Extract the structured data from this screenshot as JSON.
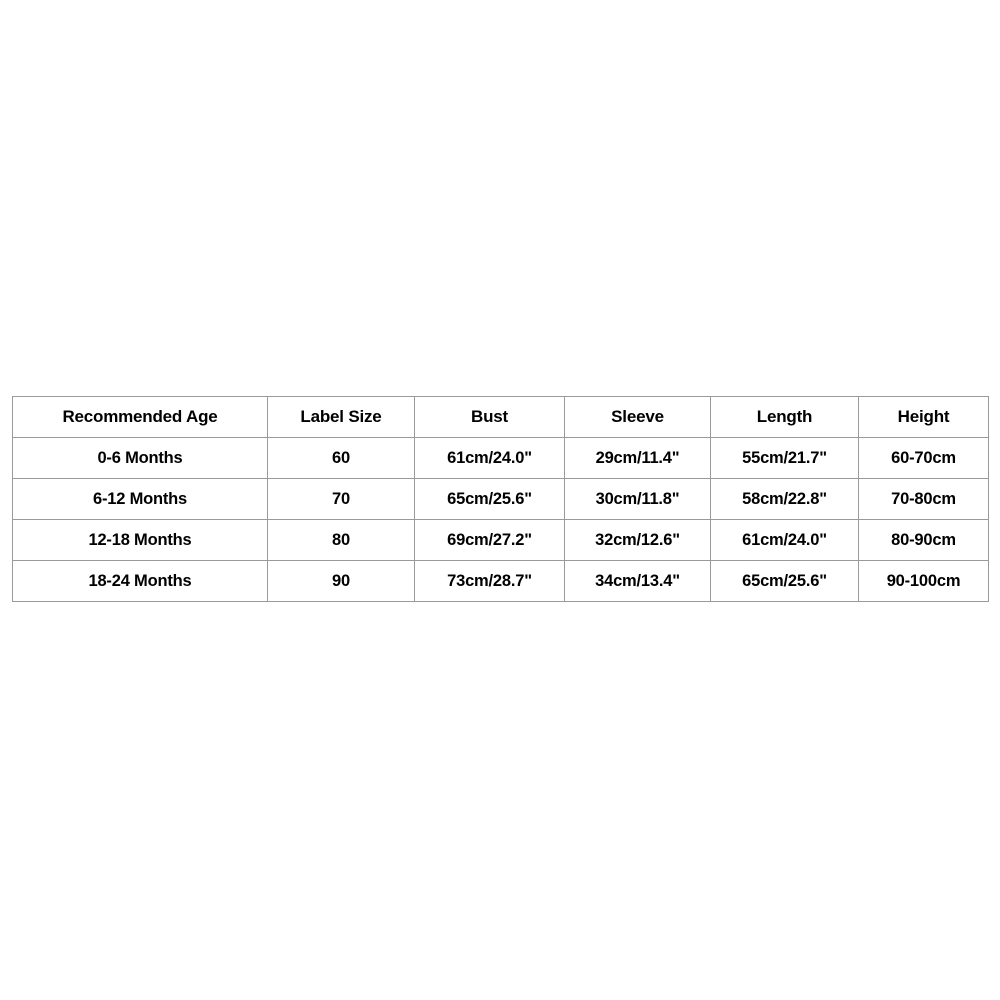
{
  "chart_data": {
    "type": "table",
    "title": "",
    "columns": [
      "Recommended Age",
      "Label Size",
      "Bust",
      "Sleeve",
      "Length",
      "Height"
    ],
    "rows": [
      [
        "0-6 Months",
        "60",
        "61cm/24.0\"",
        "29cm/11.4\"",
        "55cm/21.7\"",
        "60-70cm"
      ],
      [
        "6-12 Months",
        "70",
        "65cm/25.6\"",
        "30cm/11.8\"",
        "58cm/22.8\"",
        "70-80cm"
      ],
      [
        "12-18 Months",
        "80",
        "69cm/27.2\"",
        "32cm/12.6\"",
        "61cm/24.0\"",
        "80-90cm"
      ],
      [
        "18-24 Months",
        "90",
        "73cm/28.7\"",
        "34cm/13.4\"",
        "65cm/25.6\"",
        "90-100cm"
      ]
    ]
  },
  "table": {
    "headers": {
      "age": "Recommended Age",
      "label_size": "Label Size",
      "bust": "Bust",
      "sleeve": "Sleeve",
      "length": "Length",
      "height": "Height"
    },
    "rows": [
      {
        "age": "0-6 Months",
        "label_size": "60",
        "bust": "61cm/24.0\"",
        "sleeve": "29cm/11.4\"",
        "length": "55cm/21.7\"",
        "height": "60-70cm"
      },
      {
        "age": "6-12 Months",
        "label_size": "70",
        "bust": "65cm/25.6\"",
        "sleeve": "30cm/11.8\"",
        "length": "58cm/22.8\"",
        "height": "70-80cm"
      },
      {
        "age": "12-18 Months",
        "label_size": "80",
        "bust": "69cm/27.2\"",
        "sleeve": "32cm/12.6\"",
        "length": "61cm/24.0\"",
        "height": "80-90cm"
      },
      {
        "age": "18-24 Months",
        "label_size": "90",
        "bust": "73cm/28.7\"",
        "sleeve": "34cm/13.4\"",
        "length": "65cm/25.6\"",
        "height": "90-100cm"
      }
    ]
  },
  "colors": {
    "background": "#ffffff",
    "border": "#9a9a9a",
    "text": "#000000"
  }
}
